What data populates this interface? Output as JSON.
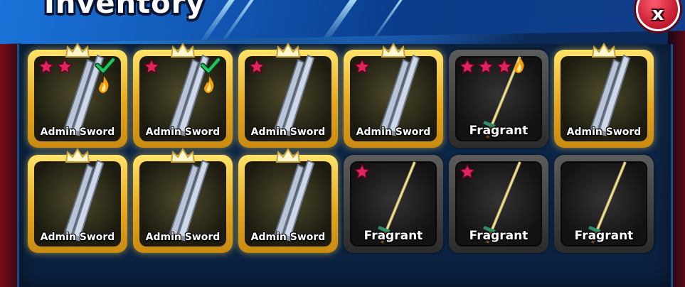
{
  "title": "Inventory",
  "close_label": "x",
  "colors": {
    "gold_frame": "#e6a81f",
    "dark_frame": "#2b2b2b",
    "star": "#e0245e",
    "check": "#22c55e"
  },
  "items": [
    {
      "label": "Admin Sword",
      "rarity": "gold",
      "stars": 2,
      "equipped": true,
      "flame": true
    },
    {
      "label": "Admin Sword",
      "rarity": "gold",
      "stars": 1,
      "equipped": true,
      "flame": true
    },
    {
      "label": "Admin Sword",
      "rarity": "gold",
      "stars": 1,
      "equipped": false,
      "flame": false
    },
    {
      "label": "Admin Sword",
      "rarity": "gold",
      "stars": 1,
      "equipped": false,
      "flame": false
    },
    {
      "label": "Fragrant",
      "rarity": "dark",
      "stars": 3,
      "equipped": false,
      "flame": true
    },
    {
      "label": "Admin Sword",
      "rarity": "gold",
      "stars": 0,
      "equipped": false,
      "flame": false
    },
    {
      "label": "Admin Sword",
      "rarity": "gold",
      "stars": 0,
      "equipped": false,
      "flame": false
    },
    {
      "label": "Admin Sword",
      "rarity": "gold",
      "stars": 0,
      "equipped": false,
      "flame": false
    },
    {
      "label": "Admin Sword",
      "rarity": "gold",
      "stars": 0,
      "equipped": false,
      "flame": false
    },
    {
      "label": "Fragrant",
      "rarity": "dark",
      "stars": 1,
      "equipped": false,
      "flame": false
    },
    {
      "label": "Fragrant",
      "rarity": "dark",
      "stars": 1,
      "equipped": false,
      "flame": false
    },
    {
      "label": "Fragrant",
      "rarity": "dark",
      "stars": 0,
      "equipped": false,
      "flame": false
    }
  ]
}
